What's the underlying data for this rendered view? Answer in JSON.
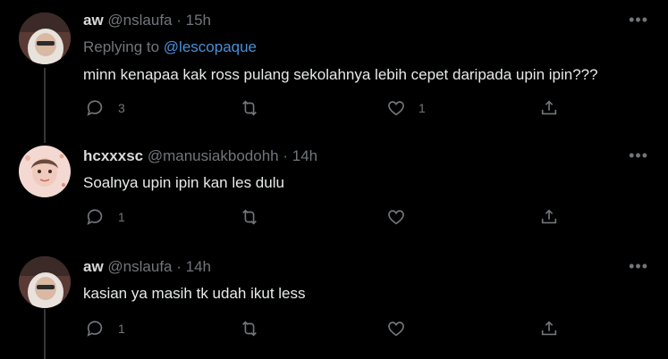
{
  "tweets": [
    {
      "name": "aw",
      "handle": "@nslaufa",
      "separator": "·",
      "time": "15h",
      "replying_prefix": "Replying to",
      "replying_to": "@lescopaque",
      "text": "minn kenapaa kak ross pulang sekolahnya lebih cepet daripada upin ipin???",
      "replies": "3",
      "retweets": "",
      "likes": "1",
      "avatar_icon": "profile-photo-woman-hijab"
    },
    {
      "name": "hcxxxsc",
      "handle": "@manusiakbodohh",
      "separator": "·",
      "time": "14h",
      "text": "Soalnya upin ipin kan les dulu",
      "replies": "1",
      "retweets": "",
      "likes": "",
      "avatar_icon": "profile-photo-girl-glitter"
    },
    {
      "name": "aw",
      "handle": "@nslaufa",
      "separator": "·",
      "time": "14h",
      "text": "kasian ya masih tk udah ikut less",
      "replies": "1",
      "retweets": "",
      "likes": "",
      "avatar_icon": "profile-photo-woman-hijab"
    }
  ],
  "more_icon": "more-dots-icon",
  "colors": {
    "background": "#000000",
    "text": "#e7e9ea",
    "muted": "#71767b",
    "link": "#4a8fd6",
    "thread_line": "#333639"
  }
}
